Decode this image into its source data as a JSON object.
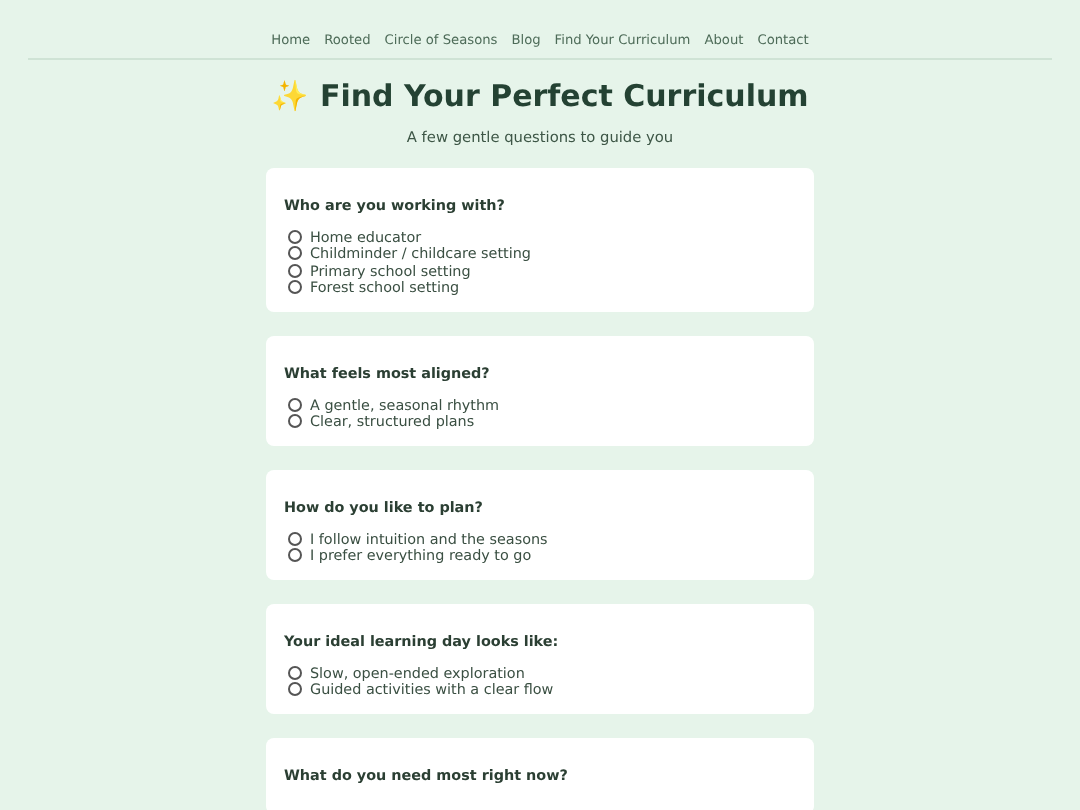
{
  "nav": {
    "items": [
      {
        "label": "Home"
      },
      {
        "label": "Rooted"
      },
      {
        "label": "Circle of Seasons"
      },
      {
        "label": "Blog"
      },
      {
        "label": "Find Your Curriculum"
      },
      {
        "label": "About"
      },
      {
        "label": "Contact"
      }
    ]
  },
  "header": {
    "title": "✨ Find Your Perfect Curriculum",
    "subtitle": "A few gentle questions to guide you"
  },
  "questions": [
    {
      "question": "Who are you working with?",
      "options": [
        {
          "label": "Home educator",
          "selected": false
        },
        {
          "label": "Childminder / childcare setting",
          "selected": false
        },
        {
          "label": "Primary school setting",
          "selected": false
        },
        {
          "label": "Forest school setting",
          "selected": false
        }
      ]
    },
    {
      "question": "What feels most aligned?",
      "options": [
        {
          "label": "A gentle, seasonal rhythm",
          "selected": false
        },
        {
          "label": "Clear, structured plans",
          "selected": false
        }
      ]
    },
    {
      "question": "How do you like to plan?",
      "options": [
        {
          "label": "I follow intuition and the seasons",
          "selected": false
        },
        {
          "label": "I prefer everything ready to go",
          "selected": false
        }
      ]
    },
    {
      "question": "Your ideal learning day looks like:",
      "options": [
        {
          "label": "Slow, open-ended exploration",
          "selected": false
        },
        {
          "label": "Guided activities with a clear flow",
          "selected": false
        }
      ]
    },
    {
      "question": "What do you need most right now?"
    }
  ]
}
